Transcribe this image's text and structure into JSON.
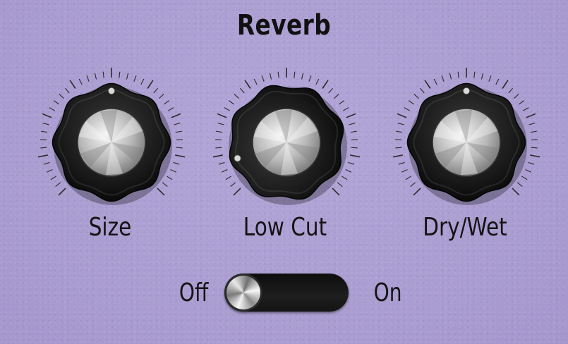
{
  "panel": {
    "title": "Reverb"
  },
  "knobs": [
    {
      "id": "size",
      "label": "Size",
      "value_fraction": 0.5
    },
    {
      "id": "low_cut",
      "label": "Low Cut",
      "value_fraction": 0.1
    },
    {
      "id": "dry_wet",
      "label": "Dry/Wet",
      "value_fraction": 0.5
    }
  ],
  "switch": {
    "off_label": "Off",
    "on_label": "On",
    "state": "off"
  },
  "colors": {
    "background": "#ac9fd2",
    "knob_body": "#1a1a1a",
    "knob_cap": "#c8c8c8",
    "text": "#141414"
  }
}
